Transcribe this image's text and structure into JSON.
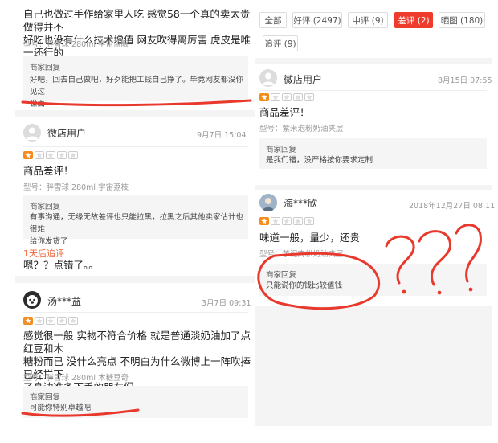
{
  "filter_tabs": [
    {
      "label": "全部",
      "active": false
    },
    {
      "label": "好评 (2497)",
      "active": false
    },
    {
      "label": "中评 (9)",
      "active": false
    },
    {
      "label": "差评 (2)",
      "active": true
    },
    {
      "label": "晒图 (180)",
      "active": false
    },
    {
      "label": "追评 (9)",
      "active": false
    }
  ],
  "left_reviews": [
    {
      "text_lines": [
        "自己也做过手作给家里人吃 感觉58一个真的卖太贵 做得并不",
        "好吃也没有什么技术增值 网友吹得离厉害 虎皮是唯一还行的"
      ],
      "spec": "型号：胖雪球 280ml 宇宙蓝眼",
      "reply_title": "商家回复",
      "reply_lines": [
        "好吧，回去自己做吧，好歹能把工钱自己挣了。毕竟网友都没你见过",
        "世面"
      ]
    },
    {
      "user": "微店用户",
      "date": "9月7日 15:04",
      "rating": 1,
      "text_lines": [
        "商品差评！"
      ],
      "spec": "型号：胖雪球 280ml 宇宙荔枝",
      "reply_title": "商家回复",
      "reply_lines": [
        "有事沟通，无缘无故差评也只能拉黑，拉黑之后其他卖家估计也很难",
        "给你发货了"
      ],
      "followup_label": "1天后追评",
      "followup_text": "嗯？？点错了。。"
    },
    {
      "user": "汤***益",
      "date": "3月7日 09:31",
      "rating": 1,
      "text_lines": [
        "感觉很一般 实物不符合价格 就是普通淡奶油加了点红豆和木",
        "糖粉而已 没什么亮点 不明白为什么微博上一阵吹捧 已经拦下",
        "了身边准备下手的朋友们"
      ],
      "spec": "型号：胖雪球 280ml 木糖豆奇",
      "reply_title": "商家回复",
      "reply_lines": [
        "可能你特别卓越吧"
      ]
    }
  ],
  "right_reviews": [
    {
      "user": "微店用户",
      "date": "8月15日 07:55",
      "rating": 1,
      "text_lines": [
        "商品差评！"
      ],
      "spec": "型号：紫米泡粉奶油夹层",
      "reply_title": "商家回复",
      "reply_lines": [
        "是我们错，没严格按你要求定制"
      ]
    },
    {
      "user": "海***欣",
      "date": "2018年12月27日 08:11",
      "rating": 1,
      "text_lines": [
        "味道一般，量少，还贵"
      ],
      "spec": "型号：芋泥肉松奶油夹层",
      "reply_title": "商家回复",
      "reply_lines": [
        "只能说你的钱比较值钱"
      ]
    }
  ],
  "colors": {
    "accent_red": "#ef3b2c",
    "star_orange": "#f58d1e",
    "annotation_red": "#e8392c",
    "followup_orange": "#f0643a"
  },
  "icons": [
    "user-avatar-icon",
    "star-icon"
  ]
}
